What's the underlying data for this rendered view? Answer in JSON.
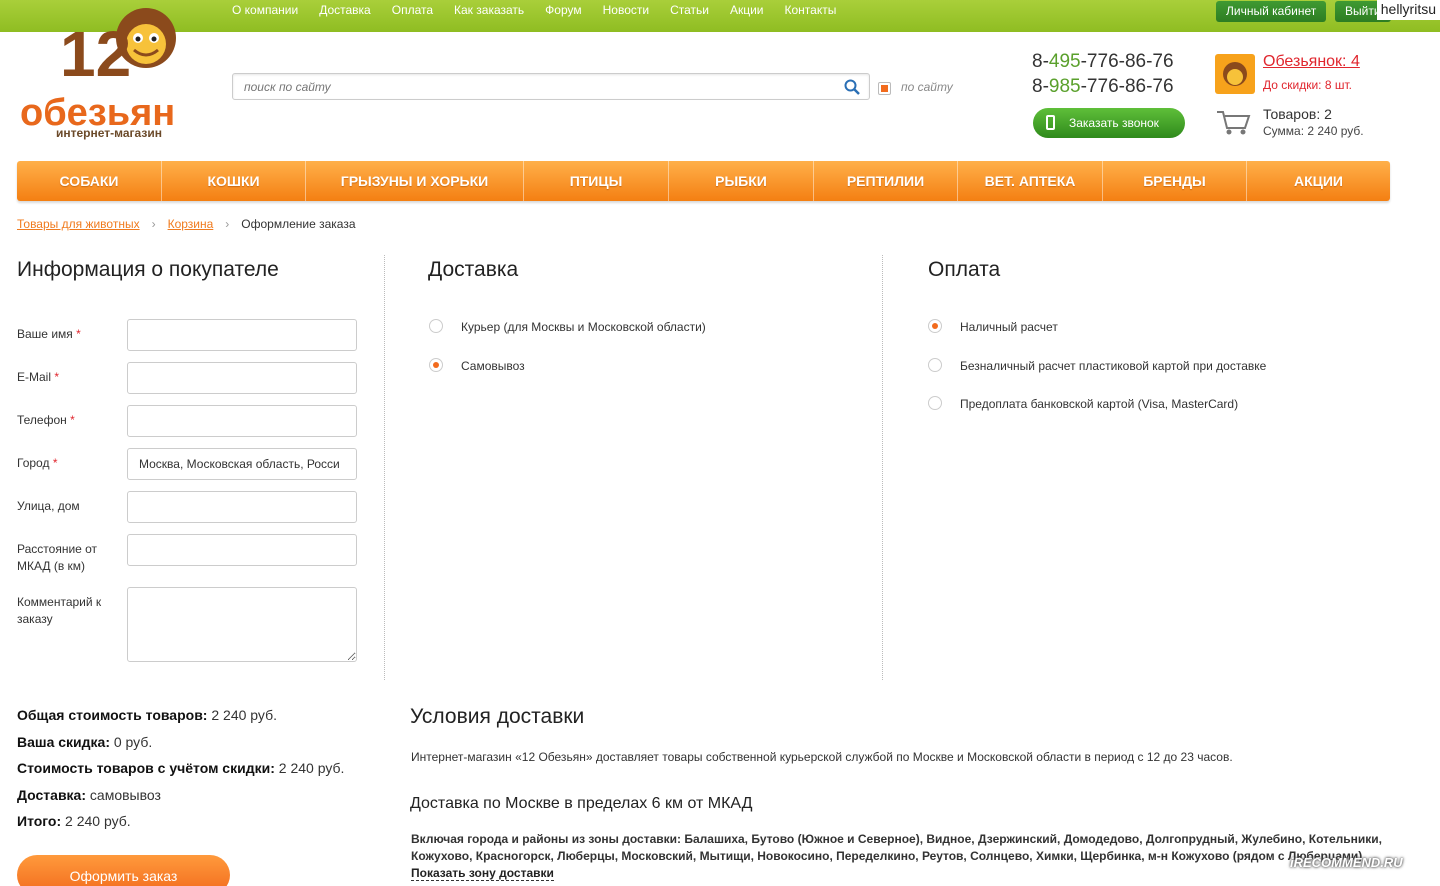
{
  "topnav": [
    "О компании",
    "Доставка",
    "Оплата",
    "Как заказать",
    "Форум",
    "Новости",
    "Статьи",
    "Акции",
    "Контакты"
  ],
  "account": {
    "cabinet": "Личный кабинет",
    "logout": "Выйти",
    "username": "hellyritsu"
  },
  "logo": {
    "number": "12",
    "word": "обезьян",
    "tagline": "интернет-магазин"
  },
  "search": {
    "placeholder": "поиск по сайту",
    "scope_label": "по сайту"
  },
  "phones": [
    {
      "prefix": "8-",
      "code": "495",
      "rest": "-776-86-76"
    },
    {
      "prefix": "8-",
      "code": "985",
      "rest": "-776-86-76"
    }
  ],
  "callback_label": "Заказать звонок",
  "monkeys": {
    "title": "Обезьянок: 4",
    "sub": "До скидки: 8 шт."
  },
  "cart": {
    "count": "Товаров: 2",
    "sum": "Сумма: 2 240 руб."
  },
  "menu": [
    "СОБАКИ",
    "КОШКИ",
    "ГРЫЗУНЫ И ХОРЬКИ",
    "ПТИЦЫ",
    "РЫБКИ",
    "РЕПТИЛИИ",
    "ВЕТ. АПТЕКА",
    "БРЕНДЫ",
    "АКЦИИ"
  ],
  "breadcrumb": {
    "c1": "Товары для животных",
    "c2": "Корзина",
    "current": "Оформление заказа",
    "sep": "›"
  },
  "buyer": {
    "title": "Информация о покупателе",
    "name_label": "Ваше имя",
    "email_label": "E-Mail",
    "phone_label": "Телефон",
    "city_label": "Город",
    "city_value": "Москва, Московская область, Росси",
    "street_label": "Улица, дом",
    "distance_label": "Расстояние от МКАД (в км)",
    "comment_label": "Комментарий к заказу",
    "required_mark": "*"
  },
  "delivery": {
    "title": "Доставка",
    "options": [
      {
        "label": "Курьер (для Москвы и Московской области)",
        "checked": false
      },
      {
        "label": "Самовывоз",
        "checked": true
      }
    ]
  },
  "payment": {
    "title": "Оплата",
    "options": [
      {
        "label": "Наличный расчет",
        "checked": true
      },
      {
        "label": "Безналичный расчет пластиковой картой при доставке",
        "checked": false
      },
      {
        "label": "Предоплата банковской картой (Visa, MasterCard)",
        "checked": false
      }
    ]
  },
  "totals": {
    "goods_label": "Общая стоимость товаров:",
    "goods_value": "2 240 руб.",
    "discount_label": "Ваша скидка:",
    "discount_value": "0 руб.",
    "after_label": "Стоимость товаров с учётом скидки:",
    "after_value": "2 240 руб.",
    "delivery_label": "Доставка:",
    "delivery_value": "самовывоз",
    "total_label": "Итого:",
    "total_value": "2 240 руб."
  },
  "order_button": "Оформить заказ",
  "conditions": {
    "title": "Условия доставки",
    "paragraph": "Интернет-магазин «12 Обезьян» доставляет товары собственной курьерской службой по Москве и Московской области в период с 12 до 23 часов.",
    "subtitle": "Доставка по Москве в пределах 6 км от МКАД",
    "zones": "Включая города и районы из зоны доставки: Балашиха, Бутово (Южное и Северное), Видное, Дзержинский, Домодедово, Долгопрудный, Жулебино, Котельники, Кожухово, Красногорск, Люберцы, Московский, Мытищи, Новокосино, Переделкино, Реутов, Солнцево, Химки, Щербинка, м-н Кожухово (рядом с Люберцами)",
    "zone_link": "Показать зону доставки"
  },
  "watermark": "iRECOMMEND.RU",
  "colors": {
    "accent_orange": "#f47f12",
    "top_green": "#8fbd22",
    "link_orange": "#f07b1e",
    "red": "#e0262e"
  }
}
